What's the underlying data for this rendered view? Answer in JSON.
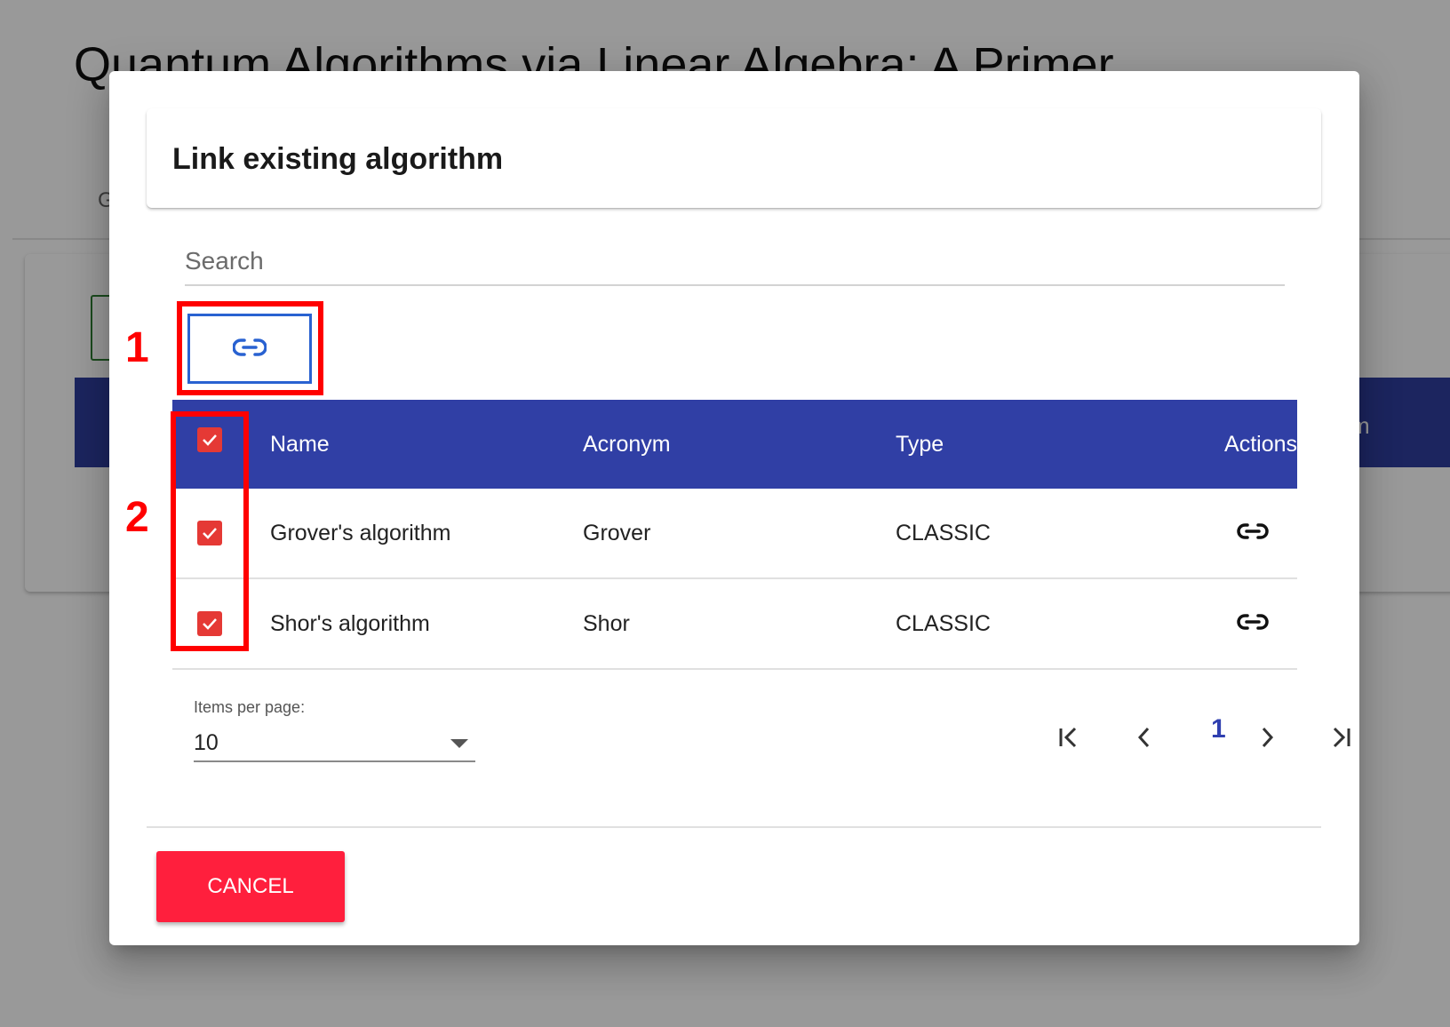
{
  "background": {
    "page_title": "Quantum Algorithms via Linear Algebra: A Primer",
    "tab_letter": "G",
    "header_fragment": "m"
  },
  "dialog": {
    "title": "Link existing algorithm",
    "search": {
      "placeholder": "Search",
      "value": ""
    },
    "table": {
      "columns": [
        "Name",
        "Acronym",
        "Type",
        "Actions"
      ],
      "select_all_checked": true,
      "rows": [
        {
          "name": "Grover's algorithm",
          "acronym": "Grover",
          "type": "CLASSIC",
          "checked": true,
          "action_icon": "link-icon"
        },
        {
          "name": "Shor's algorithm",
          "acronym": "Shor",
          "type": "CLASSIC",
          "checked": true,
          "action_icon": "link-icon"
        }
      ]
    },
    "paginator": {
      "items_per_page_label": "Items per page:",
      "items_per_page_value": "10",
      "current_page": "1"
    },
    "cancel_label": "CANCEL"
  },
  "annotations": [
    {
      "label": "1",
      "color": "#ff0000"
    },
    {
      "label": "2",
      "color": "#ff0000"
    }
  ],
  "colors": {
    "header_bg": "#303fa5",
    "checkbox": "#e53935",
    "cancel_button": "#ff1f3d",
    "link_button_border": "#2962d1",
    "current_page": "#3040b0"
  }
}
